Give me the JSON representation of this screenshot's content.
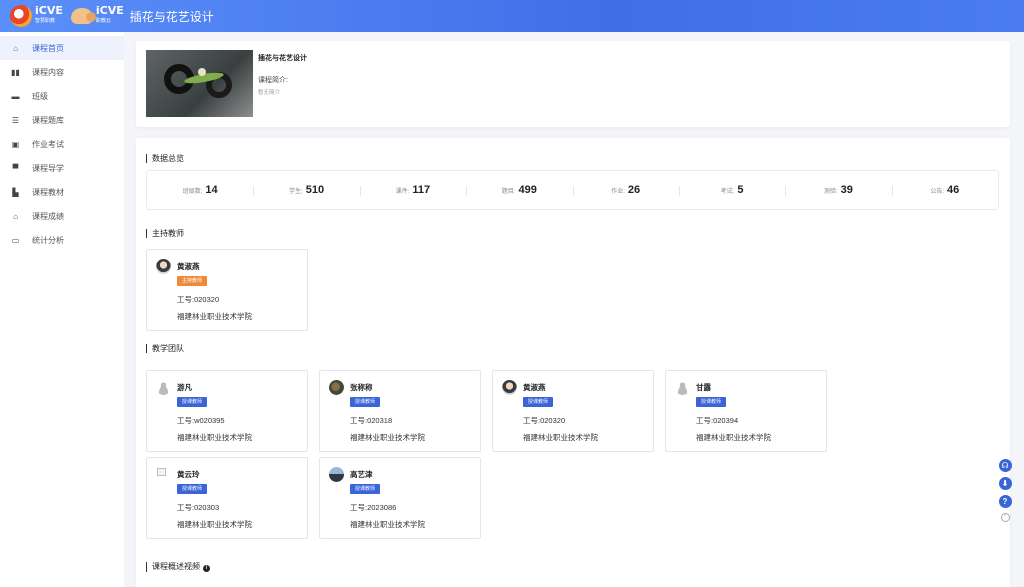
{
  "header": {
    "logo1": {
      "name": "iCVE",
      "subtitle": "智慧职教"
    },
    "logo2": {
      "name": "iCVE",
      "subtitle": "职教云"
    },
    "title": "插花与花艺设计"
  },
  "sidebar": {
    "items": [
      {
        "label": "课程首页",
        "icon": "home-icon",
        "glyph": "⌂",
        "active": true
      },
      {
        "label": "课程内容",
        "icon": "book-icon",
        "glyph": "▮▮",
        "active": false
      },
      {
        "label": "班级",
        "icon": "class-icon",
        "glyph": "▬",
        "active": false
      },
      {
        "label": "课程题库",
        "icon": "list-icon",
        "glyph": "☰",
        "active": false
      },
      {
        "label": "作业考试",
        "icon": "homework-icon",
        "glyph": "▣",
        "active": false
      },
      {
        "label": "课程导学",
        "icon": "guide-icon",
        "glyph": "▀",
        "active": false
      },
      {
        "label": "课程教材",
        "icon": "textbook-icon",
        "glyph": "▙",
        "active": false
      },
      {
        "label": "课程成绩",
        "icon": "grade-icon",
        "glyph": "⌂",
        "active": false
      },
      {
        "label": "统计分析",
        "icon": "analytics-icon",
        "glyph": "▭",
        "active": false
      }
    ]
  },
  "course": {
    "name": "插花与花艺设计",
    "intro_label": "课程简介:",
    "intro_value": "暂无简介"
  },
  "overview": {
    "title": "数据总览",
    "stats": [
      {
        "label": "班级数:",
        "value": "14"
      },
      {
        "label": "学生:",
        "value": "510"
      },
      {
        "label": "课件:",
        "value": "117"
      },
      {
        "label": "题目:",
        "value": "499"
      },
      {
        "label": "作业:",
        "value": "26"
      },
      {
        "label": "考试:",
        "value": "5"
      },
      {
        "label": "测验:",
        "value": "39"
      },
      {
        "label": "公告:",
        "value": "46"
      }
    ]
  },
  "host": {
    "title": "主持教师",
    "teachers": [
      {
        "name": "黄淑燕",
        "role": "主持教师",
        "id": "工号:020320",
        "school": "福建林业职业技术学院"
      }
    ]
  },
  "team": {
    "title": "教学团队",
    "teachers": [
      {
        "name": "游凡",
        "role": "授课教师",
        "id": "工号:w020395",
        "school": "福建林业职业技术学院"
      },
      {
        "name": "张称称",
        "role": "授课教师",
        "id": "工号:020318",
        "school": "福建林业职业技术学院"
      },
      {
        "name": "黄淑燕",
        "role": "授课教师",
        "id": "工号:020320",
        "school": "福建林业职业技术学院"
      },
      {
        "name": "甘露",
        "role": "授课教师",
        "id": "工号:020394",
        "school": "福建林业职业技术学院"
      },
      {
        "name": "黄云玲",
        "role": "授课教师",
        "id": "工号:020303",
        "school": "福建林业职业技术学院"
      },
      {
        "name": "高艺津",
        "role": "授课教师",
        "id": "工号:2023086",
        "school": "福建林业职业技术学院"
      }
    ]
  },
  "video": {
    "title": "课程概述视频"
  },
  "colors": {
    "header": "#3f6fe8",
    "accent": "#3a64d8",
    "host_badge": "#ee8a3a"
  },
  "float_tools": [
    "customer-service-icon",
    "download-icon",
    "help-icon",
    "top-icon"
  ]
}
